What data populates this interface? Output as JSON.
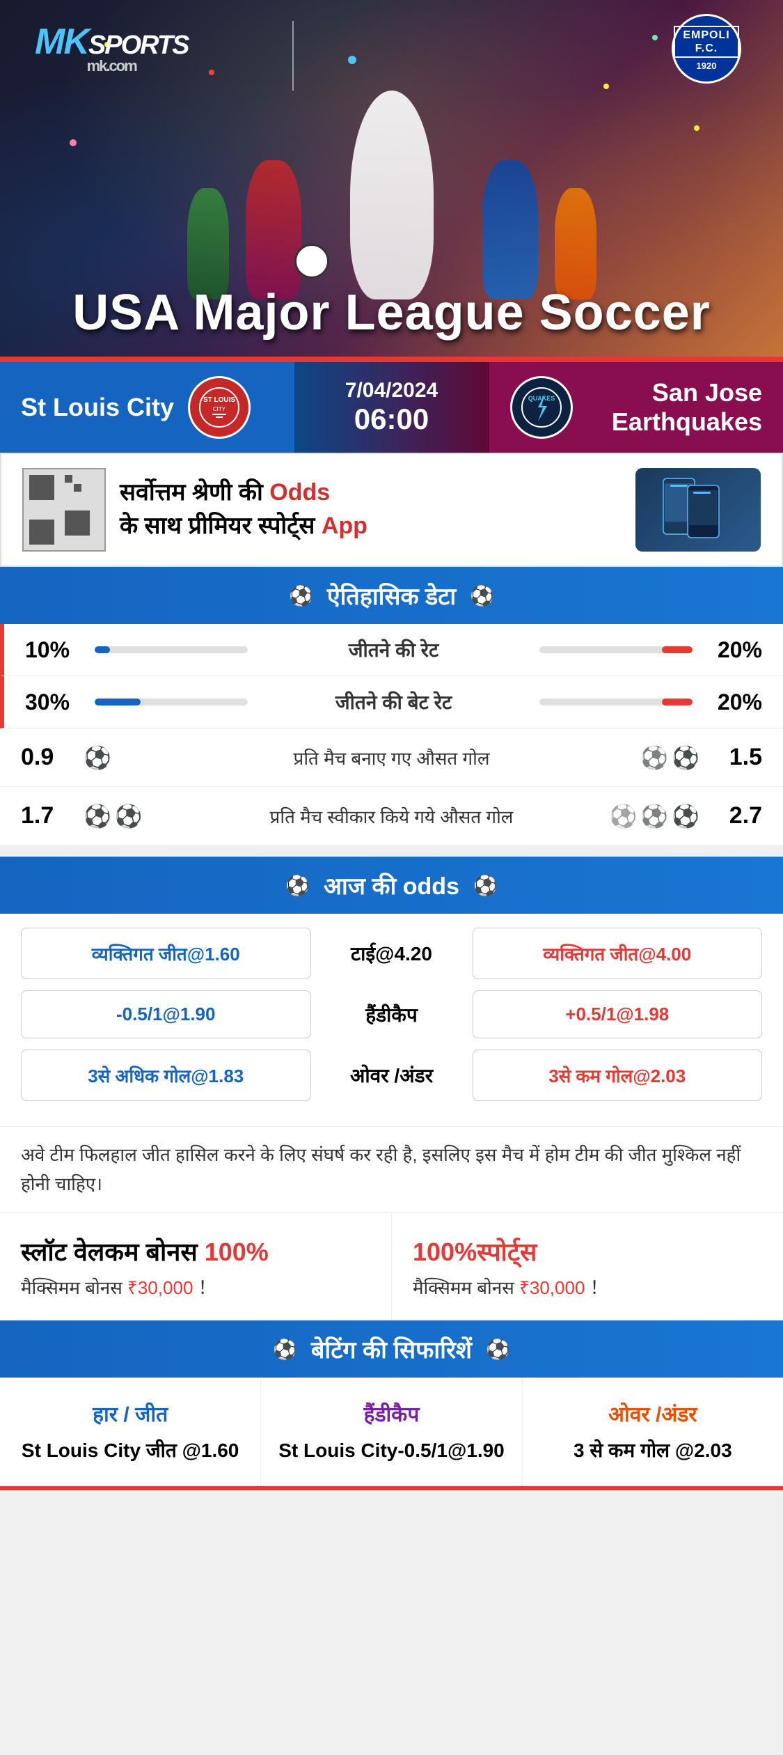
{
  "brand": {
    "name": "MK SPORTS",
    "url": "mk.com",
    "mk_label": "MK",
    "sports_label": "SPORTS",
    "partner": "EMPOLI F.C.",
    "partner_year": "1920"
  },
  "hero": {
    "title": "USA Major League Soccer"
  },
  "match": {
    "home_team": "St Louis City",
    "away_team": "San Jose Earthquakes",
    "away_short": "QUAKES",
    "date": "7/04/2024",
    "time": "06:00"
  },
  "promo": {
    "text_line1": "सर्वोत्तम श्रेणी की",
    "text_bold": "Odds",
    "text_line2": "के साथ प्रीमियर स्पोर्ट्स",
    "text_app": "App"
  },
  "historical": {
    "section_title": "ऐतिहासिक डेटा",
    "stats": [
      {
        "label": "जीतने की रेट",
        "left_val": "10%",
        "right_val": "20%",
        "left_pct": 10,
        "right_pct": 20
      },
      {
        "label": "जीतने की बेट रेट",
        "left_val": "30%",
        "right_val": "20%",
        "left_pct": 30,
        "right_pct": 20
      }
    ],
    "goal_stats": [
      {
        "label": "प्रति मैच बनाए गए औसत गोल",
        "left_val": "0.9",
        "right_val": "1.5",
        "left_balls": 1,
        "right_balls": 2
      },
      {
        "label": "प्रति मैच स्वीकार किये गये औसत गोल",
        "left_val": "1.7",
        "right_val": "2.7",
        "left_balls": 2,
        "right_balls": 3
      }
    ]
  },
  "odds": {
    "section_title": "आज की odds",
    "rows": [
      {
        "left": "व्यक्तिगत जीत@1.60",
        "center": "टाई@4.20",
        "right": "व्यक्तिगत जीत@4.00"
      },
      {
        "left": "-0.5/1@1.90",
        "center": "हैंडीकैप",
        "right": "+0.5/1@1.98"
      },
      {
        "left": "3से अधिक गोल@1.83",
        "center": "ओवर /अंडर",
        "right": "3से कम गोल@2.03"
      }
    ]
  },
  "notice": {
    "text": "अवे टीम फिलहाल जीत हासिल करने के लिए संघर्ष कर रही है, इसलिए इस मैच में होम टीम की जीत मुश्किल नहीं होनी चाहिए।"
  },
  "bonus": {
    "left_title": "स्लॉट वेलकम बोनस",
    "left_pct": "100%",
    "left_subtitle": "मैक्सिमम बोनस",
    "left_amount": "₹30,000",
    "left_suffix": "！",
    "right_title": "100%स्पोर्ट्स",
    "right_subtitle": "मैक्सिमम बोनस",
    "right_amount": "₹30,000",
    "right_suffix": "！"
  },
  "betting": {
    "section_title": "बेटिंग की सिफारिशें",
    "cols": [
      {
        "title": "हार / जीत",
        "value": "St Louis City जीत @1.60",
        "color": "blue"
      },
      {
        "title": "हैंडीकैप",
        "value": "St Louis City-0.5/1@1.90",
        "color": "purple"
      },
      {
        "title": "ओवर /अंडर",
        "value": "3 से कम गोल @2.03",
        "color": "orange"
      }
    ]
  }
}
